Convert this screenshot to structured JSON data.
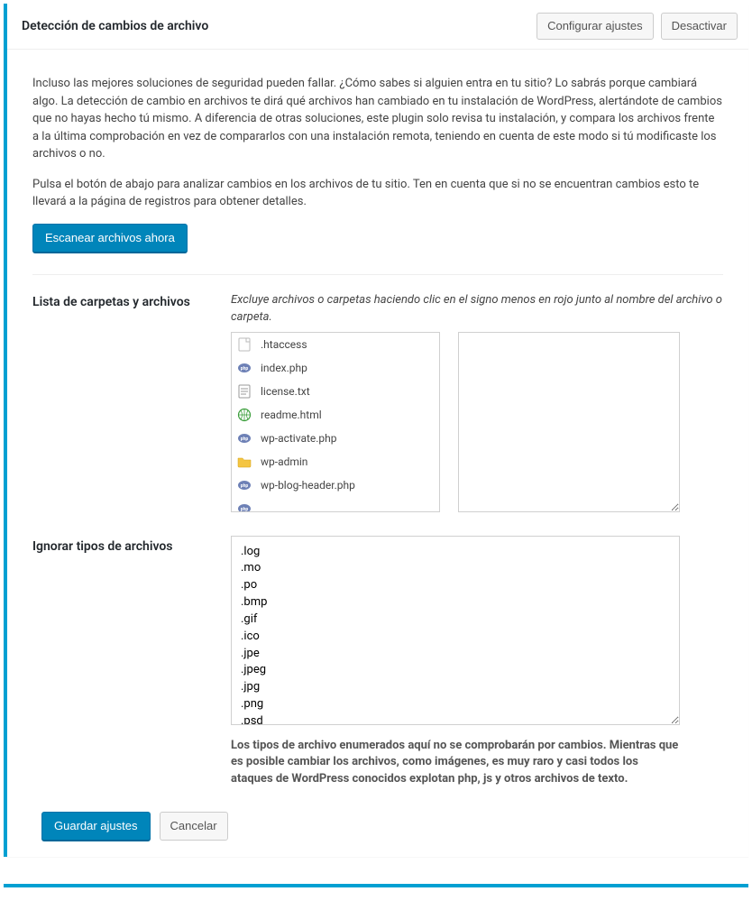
{
  "header": {
    "title": "Detección de cambios de archivo",
    "configure_label": "Configurar ajustes",
    "deactivate_label": "Desactivar"
  },
  "intro": {
    "p1": "Incluso las mejores soluciones de seguridad pueden fallar. ¿Cómo sabes si alguien entra en tu sitio? Lo sabrás porque cambiará algo. La detección de cambio en archivos te dirá qué archivos han cambiado en tu instalación de WordPress, alertándote de cambios que no hayas hecho tú mismo. A diferencia de otras soluciones, este plugin solo revisa tu instalación, y compara los archivos frente a la última comprobación en vez de compararlos con una instalación remota, teniendo en cuenta de este modo si tú modificaste los archivos o no.",
    "p2": "Pulsa el botón de abajo para analizar cambios en los archivos de tu sitio. Ten en cuenta que si no se encuentran cambios esto te llevará a la página de registros para obtener detalles.",
    "scan_button": "Escanear archivos ahora"
  },
  "folders_section": {
    "label": "Lista de carpetas y archivos",
    "hint": "Excluye archivos o carpetas haciendo clic en el signo menos en rojo junto al nombre del archivo o carpeta.",
    "items": [
      {
        "name": ".htaccess",
        "icon": "generic"
      },
      {
        "name": "index.php",
        "icon": "php"
      },
      {
        "name": "license.txt",
        "icon": "txt"
      },
      {
        "name": "readme.html",
        "icon": "html"
      },
      {
        "name": "wp-activate.php",
        "icon": "php"
      },
      {
        "name": "wp-admin",
        "icon": "folder"
      },
      {
        "name": "wp-blog-header.php",
        "icon": "php"
      }
    ],
    "textarea_value": ""
  },
  "ignore_section": {
    "label": "Ignorar tipos de archivos",
    "value": ".log\n.mo\n.po\n.bmp\n.gif\n.ico\n.jpe\n.jpeg\n.jpg\n.png\n.psd",
    "note": "Los tipos de archivo enumerados aquí no se comprobarán por cambios. Mientras que es posible cambiar los archivos, como imágenes, es muy raro y casi todos los ataques de WordPress conocidos explotan php, js y otros archivos de texto."
  },
  "actions": {
    "save": "Guardar ajustes",
    "cancel": "Cancelar"
  }
}
